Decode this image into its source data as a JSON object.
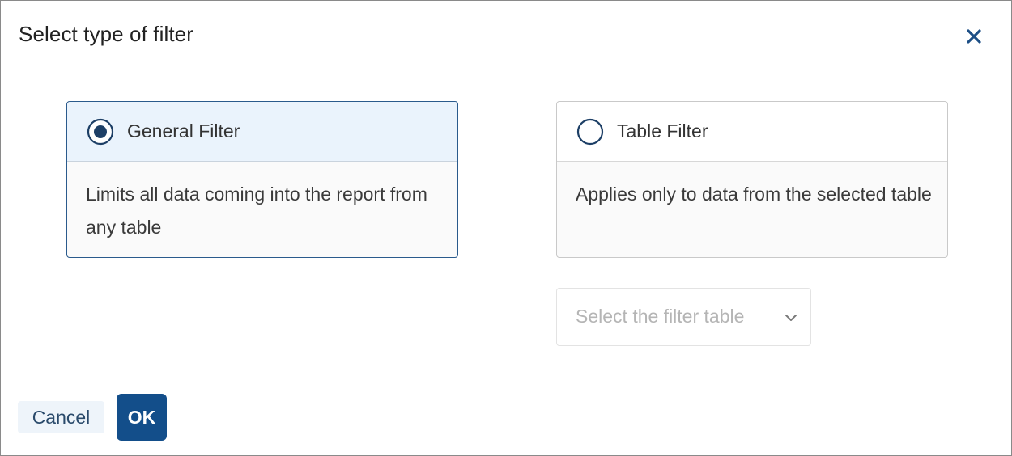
{
  "dialog": {
    "title": "Select type of filter"
  },
  "options": [
    {
      "label": "General Filter",
      "description": "Limits all data coming into the report from any table",
      "selected": true
    },
    {
      "label": "Table Filter",
      "description": "Applies only to data from the selected table",
      "selected": false
    }
  ],
  "filter_table_select": {
    "placeholder": "Select the filter table"
  },
  "buttons": {
    "cancel": "Cancel",
    "ok": "OK"
  },
  "colors": {
    "primary": "#134e8a",
    "selected_border": "#2a5a8c",
    "selected_header_bg": "#eaf3fc",
    "cancel_bg": "#eef4fa"
  },
  "icons": {
    "close": "close-icon",
    "radio_selected": "radio-selected-icon",
    "radio_unselected": "radio-unselected-icon",
    "chevron": "chevron-down-icon"
  }
}
